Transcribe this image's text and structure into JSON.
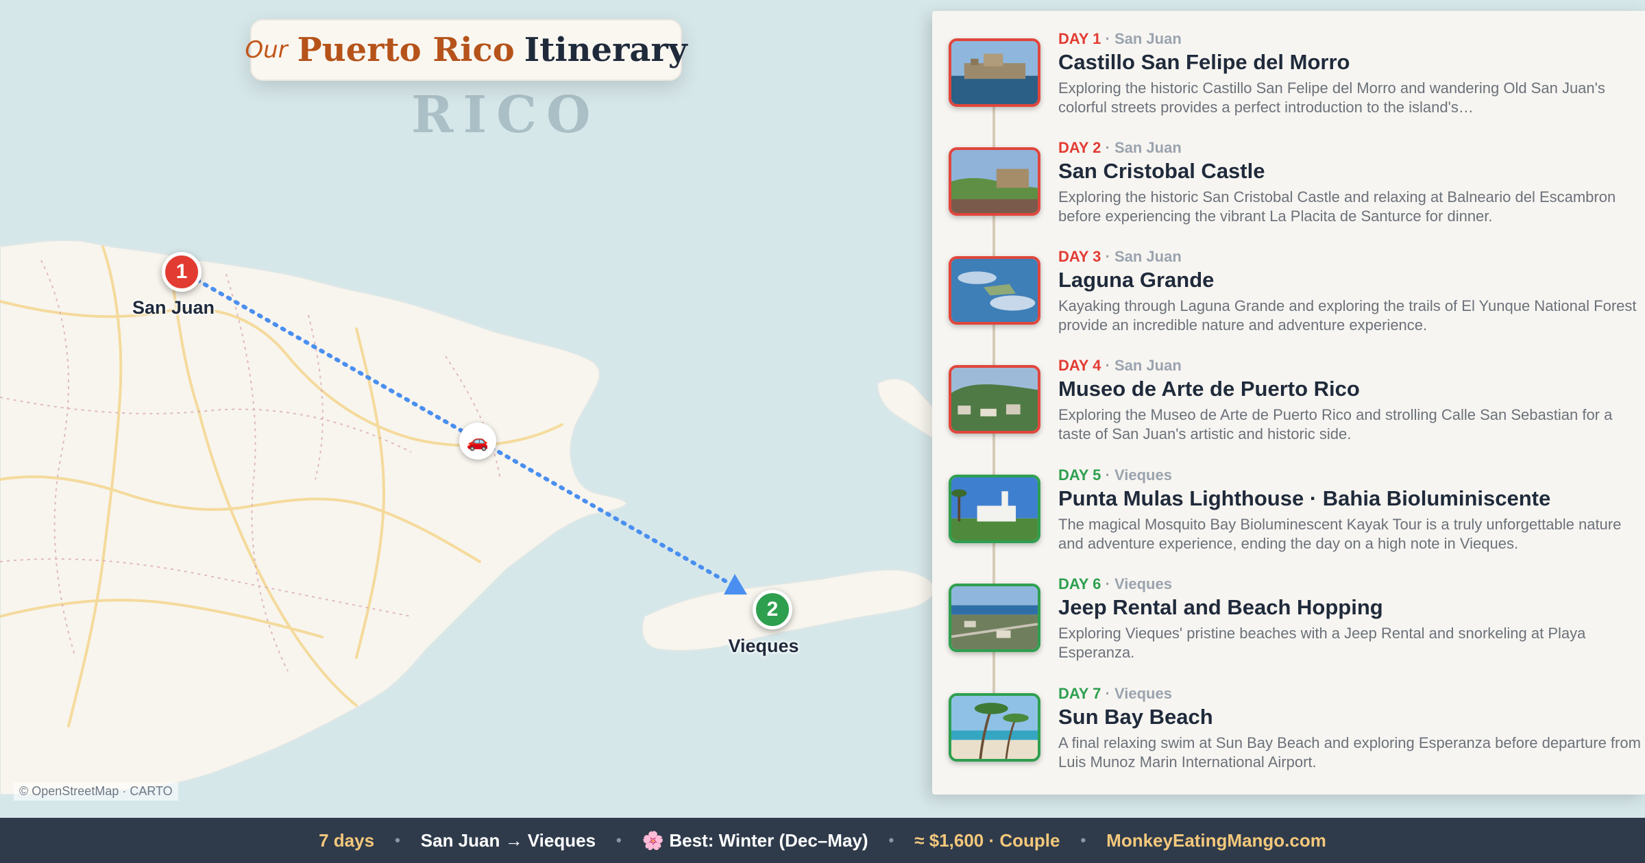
{
  "title": {
    "prefix": "Our",
    "main": "Puerto Rico",
    "suffix": "Itinerary"
  },
  "sea_label": "RICO",
  "route": {
    "stops": [
      {
        "number": "1",
        "name": "San Juan",
        "color": "#e23b32"
      },
      {
        "number": "2",
        "name": "Vieques",
        "color": "#2e9f4f"
      }
    ],
    "mode_icon": "car-icon",
    "mode_glyph": "🚗",
    "line_color": "#4a8ff0"
  },
  "attribution": "© OpenStreetMap · CARTO",
  "days": [
    {
      "label": "DAY 1",
      "separator": "·",
      "city": "San Juan",
      "title": "Castillo San Felipe del Morro",
      "description": "Exploring the historic Castillo San Felipe del Morro and wandering Old San Juan's colorful streets provides a perfect introduction to the island's…",
      "accent": "red"
    },
    {
      "label": "DAY 2",
      "separator": "·",
      "city": "San Juan",
      "title": "San Cristobal Castle",
      "description": "Exploring the historic San Cristobal Castle and relaxing at Balneario del Escambron before experiencing the vibrant La Placita de Santurce for dinner.",
      "accent": "red"
    },
    {
      "label": "DAY 3",
      "separator": "·",
      "city": "San Juan",
      "title": "Laguna Grande",
      "description": "Kayaking through Laguna Grande and exploring the trails of El Yunque National Forest provide an incredible nature and adventure experience.",
      "accent": "red"
    },
    {
      "label": "DAY 4",
      "separator": "·",
      "city": "San Juan",
      "title": "Museo de Arte de Puerto Rico",
      "description": "Exploring the Museo de Arte de Puerto Rico and strolling Calle San Sebastian for a taste of San Juan's artistic and historic side.",
      "accent": "red"
    },
    {
      "label": "DAY 5",
      "separator": "·",
      "city": "Vieques",
      "title": "Punta Mulas Lighthouse · Bahia Bioluminiscente",
      "description": "The magical Mosquito Bay Bioluminescent Kayak Tour is a truly unforgettable nature and adventure experience, ending the day on a high note in Vieques.",
      "accent": "green"
    },
    {
      "label": "DAY 6",
      "separator": "·",
      "city": "Vieques",
      "title": "Jeep Rental and Beach Hopping",
      "description": "Exploring Vieques' pristine beaches with a Jeep Rental and snorkeling at Playa Esperanza.",
      "accent": "green"
    },
    {
      "label": "DAY 7",
      "separator": "·",
      "city": "Vieques",
      "title": "Sun Bay Beach",
      "description": "A final relaxing swim at Sun Bay Beach and exploring Esperanza before departure from Luis Munoz Marin International Airport.",
      "accent": "green"
    }
  ],
  "footer": {
    "duration": "7 days",
    "route": "San Juan → Vieques",
    "season_icon": "🌸",
    "season": "Best: Winter (Dec–May)",
    "budget": "≈ $1,600 · Couple",
    "site": "MonkeyEatingMango.com",
    "separator": "•"
  },
  "colors": {
    "red": "#e23b32",
    "green": "#2e9f4f",
    "footer_bg": "#2f3b4b",
    "accent_yellow": "#f4c87c",
    "water": "#d6e7ea",
    "land": "#f8f5ee"
  }
}
